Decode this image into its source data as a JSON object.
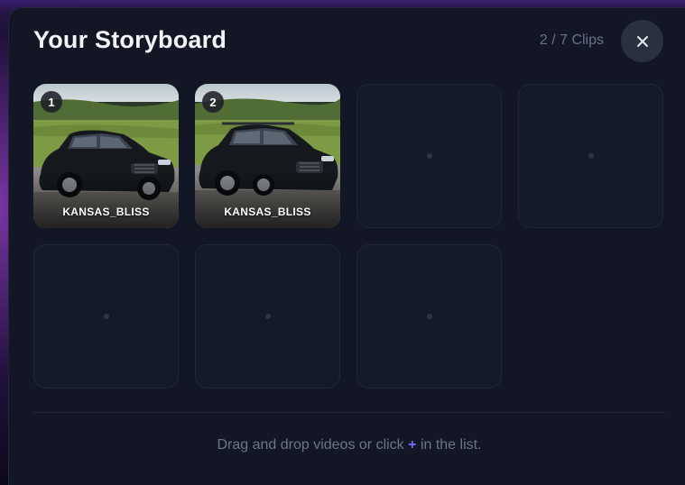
{
  "header": {
    "title": "Your Storyboard",
    "clip_count": "2 / 7 Clips",
    "close_icon": "close-icon"
  },
  "slots": [
    {
      "number": "1",
      "name": "KANSAS_BLISS",
      "filled": true
    },
    {
      "number": "2",
      "name": "KANSAS_BLISS",
      "filled": true
    },
    {
      "filled": false
    },
    {
      "filled": false
    },
    {
      "filled": false
    },
    {
      "filled": false
    },
    {
      "filled": false
    }
  ],
  "footer": {
    "hint_before": "Drag and drop videos or click",
    "hint_plus": "+",
    "hint_after": "in the list."
  },
  "colors": {
    "panel_bg": "#131725",
    "accent": "#7b6cf6",
    "muted_text": "#6a7089"
  }
}
